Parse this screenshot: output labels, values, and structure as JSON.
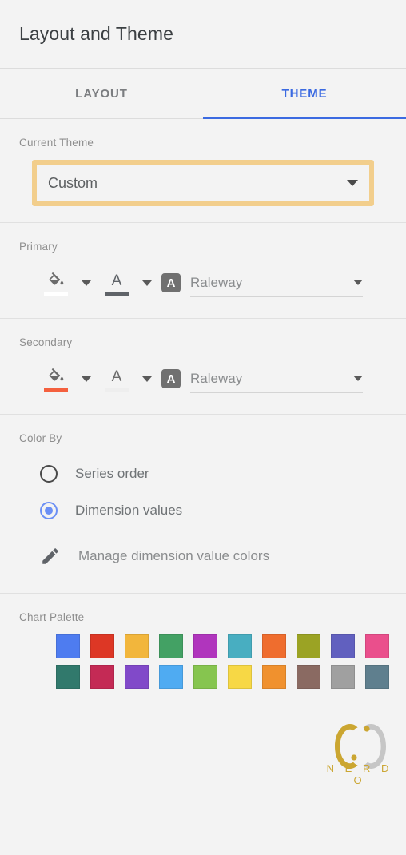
{
  "header": {
    "title": "Layout and Theme"
  },
  "tabs": [
    {
      "label": "LAYOUT",
      "active": false
    },
    {
      "label": "THEME",
      "active": true
    }
  ],
  "current_theme": {
    "label": "Current Theme",
    "value": "Custom",
    "highlight_color": "#f2ce8c",
    "caret_icon": "chevron-down-icon"
  },
  "primary": {
    "label": "Primary",
    "fill_icon": "paint-bucket-icon",
    "fill_color": "#ffffff",
    "text_icon": "text-color-icon",
    "text_color": "#5f6368",
    "font_badge": "A",
    "font_name": "Raleway"
  },
  "secondary": {
    "label": "Secondary",
    "fill_icon": "paint-bucket-icon",
    "fill_color": "#f4603e",
    "text_icon": "text-color-icon",
    "text_color": "#eeeeee",
    "font_badge": "A",
    "font_name": "Raleway"
  },
  "color_by": {
    "label": "Color By",
    "options": [
      {
        "label": "Series order",
        "selected": false
      },
      {
        "label": "Dimension values",
        "selected": true
      }
    ],
    "selected_color": "#6b8ff5"
  },
  "manage_colors": {
    "icon": "pencil-icon",
    "label": "Manage dimension value colors"
  },
  "chart_palette": {
    "label": "Chart Palette",
    "colors": [
      "#4e7cf0",
      "#dd3725",
      "#f2b63c",
      "#43a164",
      "#b035bd",
      "#48aec1",
      "#ef6d2e",
      "#9ba324",
      "#6160bf",
      "#ea4f8c",
      "#31796c",
      "#c42a55",
      "#8149c9",
      "#4fabf2",
      "#86c54f",
      "#f7d845",
      "#f0912e",
      "#8a6a62",
      "#a0a0a0",
      "#5f7f8e"
    ]
  },
  "watermark": {
    "text": "N E R D O",
    "gold": "#c9a227",
    "gray": "#b4b4b4"
  }
}
